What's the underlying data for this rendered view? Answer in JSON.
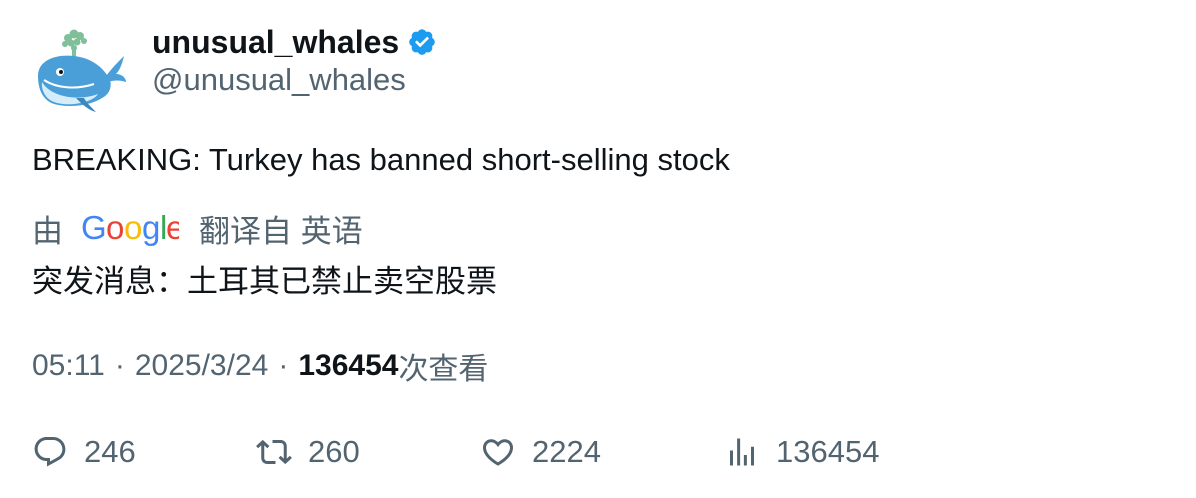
{
  "author": {
    "display_name": "unusual_whales",
    "handle": "@unusual_whales",
    "verified_color": "#1d9bf0"
  },
  "tweet": {
    "text": "BREAKING: Turkey has banned short-selling stock",
    "translation": {
      "by_label": "由",
      "provider": "Google",
      "from_label": "翻译自 英语",
      "text": "突发消息：土耳其已禁止卖空股票"
    },
    "meta": {
      "time": "05:11",
      "separator": "·",
      "date": "2025/3/24",
      "views_count": "136454",
      "views_label": "次查看"
    }
  },
  "actions": {
    "replies": "246",
    "retweets": "260",
    "likes": "2224",
    "views": "136454"
  },
  "icons": {
    "reply": "reply-bubble-icon",
    "retweet": "retweet-arrows-icon",
    "like": "heart-icon",
    "views": "bar-chart-icon",
    "verified": "verified-badge-icon"
  }
}
